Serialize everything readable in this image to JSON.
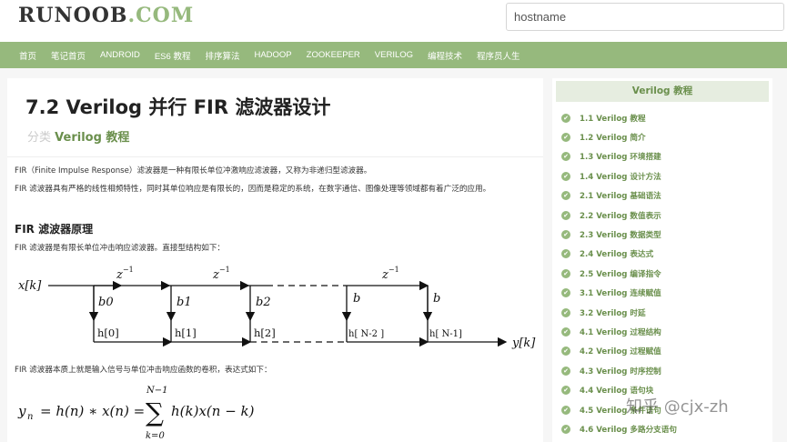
{
  "header": {
    "logo_dark": "RUNOOB",
    "logo_green": ".COM",
    "search_value": "hostname"
  },
  "nav": {
    "items": [
      "首页",
      "笔记首页",
      "ANDROID",
      "ES6 教程",
      "排序算法",
      "HADOOP",
      "ZOOKEEPER",
      "VERILOG",
      "编程技术",
      "程序员人生"
    ]
  },
  "article": {
    "title": "7.2 Verilog 并行 FIR 滤波器设计",
    "category_prefix": "分类",
    "category_link": "Verilog 教程",
    "para1": "FIR（Finite Impulse Response）滤波器是一种有限长单位冲激响应滤波器，又称为非递归型滤波器。",
    "para2": "FIR 滤波器具有严格的线性相频特性，同时其单位响应是有限长的，因而是稳定的系统，在数字通信、图像处理等领域都有着广泛的应用。",
    "heading": "FIR 滤波器原理",
    "para3": "FIR 滤波器是有限长单位冲击响应滤波器。直接型结构如下：",
    "para4": "FIR 滤波器本质上就是输入信号与单位冲击响应函数的卷积，表达式如下："
  },
  "diagram": {
    "input": "x[k]",
    "output": "y[k]",
    "delay": "z",
    "delay_exp": "−1",
    "coefs": [
      "b0",
      "b1",
      "b2",
      "b",
      "b"
    ],
    "taps": [
      "h[0]",
      "h[1]",
      "h[2]",
      "h[ N-2 ]",
      "h[ N-1]"
    ]
  },
  "formula": {
    "lhs": "y",
    "lhs_sub": "n",
    "rhs": "= h(n) ∗ x(n) =",
    "sum_top": "N−1",
    "sum_bottom": "k=0",
    "sum_sign": "∑",
    "term": "h(k)x(n − k)"
  },
  "sidebar": {
    "title": "Verilog 教程",
    "items": [
      "1.1 Verilog 教程",
      "1.2 Verilog 简介",
      "1.3 Verilog 环境搭建",
      "1.4 Verilog 设计方法",
      "2.1 Verilog 基础语法",
      "2.2 Verilog 数值表示",
      "2.3 Verilog 数据类型",
      "2.4 Verilog 表达式",
      "2.5 Verilog 编译指令",
      "3.1 Verilog 连续赋值",
      "3.2 Verilog 时延",
      "4.1 Verilog 过程结构",
      "4.2 Verilog 过程赋值",
      "4.3 Verilog 时序控制",
      "4.4 Verilog 语句块",
      "4.5 Verilog 条件语句",
      "4.6 Verilog 多路分支语句"
    ]
  },
  "watermark": "知乎 @cjx-zh",
  "colors": {
    "accent": "#96b97d",
    "link": "#6a8f4c",
    "sidebar_head_bg": "#e6ede0"
  }
}
